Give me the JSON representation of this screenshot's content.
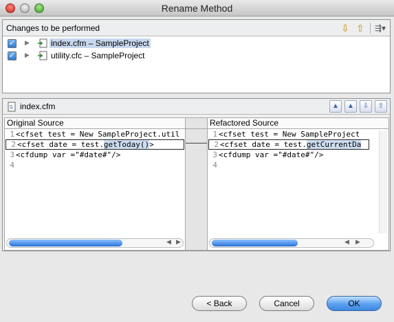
{
  "window": {
    "title": "Rename Method"
  },
  "changes_panel": {
    "label": "Changes to be performed",
    "tools": [
      "down-arrow-icon",
      "up-arrow-icon",
      "filter-menu-icon"
    ],
    "items": [
      {
        "checked": true,
        "label": "index.cfm – SampleProject",
        "selected": true
      },
      {
        "checked": true,
        "label": "utility.cfc – SampleProject",
        "selected": false
      }
    ]
  },
  "compare": {
    "file": "index.cfm",
    "left": {
      "title": "Original Source",
      "lines": [
        {
          "num": "1",
          "text": "<cfset test = New SampleProject.util"
        },
        {
          "num": "2",
          "text": "<cfset date = test.",
          "highlight": "getToday()",
          "rest": ">"
        },
        {
          "num": "3",
          "text": "<cfdump var =\"#date#\"/>"
        },
        {
          "num": "4",
          "text": ""
        }
      ]
    },
    "right": {
      "title": "Refactored Source",
      "lines": [
        {
          "num": "1",
          "text": "<cfset test = New SampleProject"
        },
        {
          "num": "2",
          "text": "<cfset date = test.",
          "highlight": "getCurrentDa",
          "rest": ""
        },
        {
          "num": "3",
          "text": "<cfdump var =\"#date#\"/>"
        },
        {
          "num": "4",
          "text": ""
        }
      ]
    }
  },
  "buttons": {
    "back": "< Back",
    "cancel": "Cancel",
    "ok": "OK"
  }
}
